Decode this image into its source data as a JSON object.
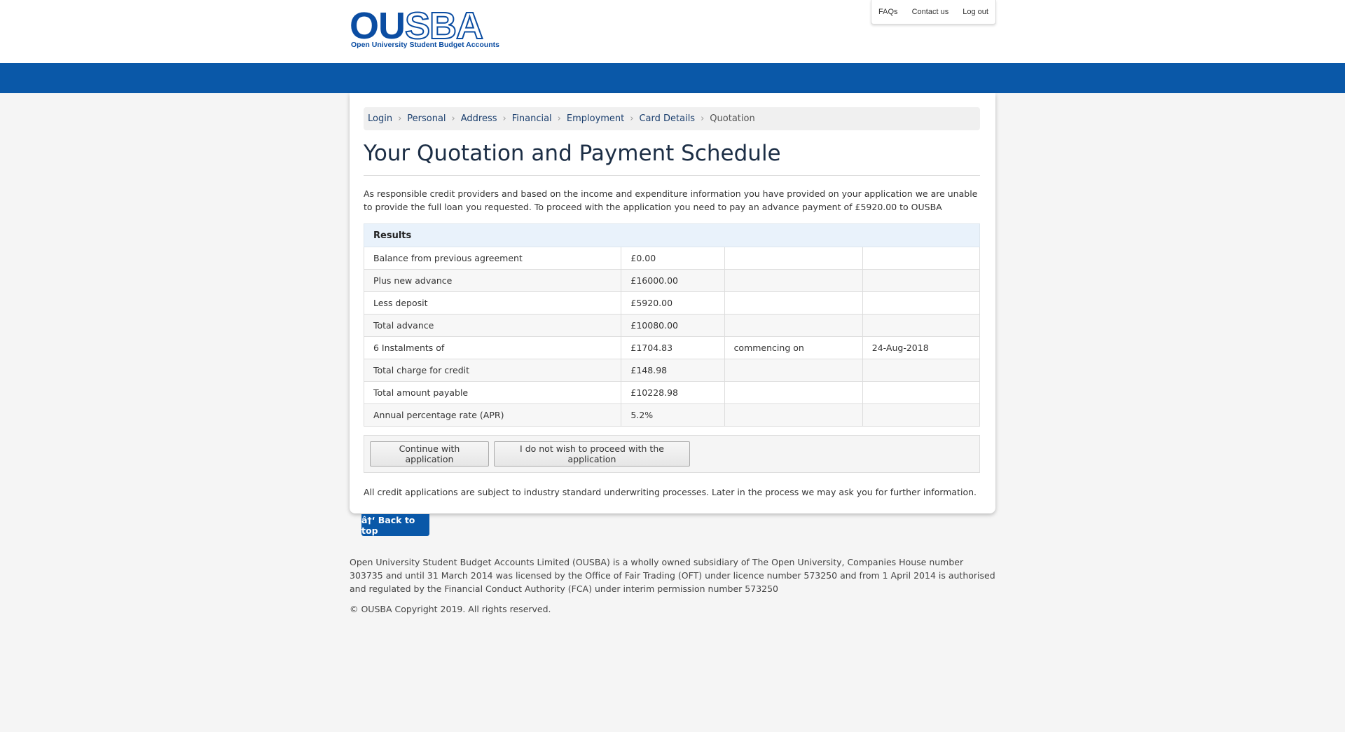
{
  "header": {
    "logo_word_ou": "OU",
    "logo_word_sba": "SBA",
    "logo_tagline": "Open University Student Budget Accounts",
    "links": [
      "FAQs",
      "Contact us",
      "Log out"
    ]
  },
  "breadcrumb": [
    "Login",
    "Personal",
    "Address",
    "Financial",
    "Employment",
    "Card Details",
    "Quotation"
  ],
  "page_title": "Your Quotation and Payment Schedule",
  "intro": "As responsible credit providers and based on the income and expenditure information you have provided on your application we are unable to provide the full loan you requested. To proceed with the application you need to pay an advance payment of £5920.00 to OUSBA",
  "results": {
    "heading": "Results",
    "rows": [
      {
        "label": "Balance from previous agreement",
        "value": "£0.00",
        "extra_label": "",
        "extra_value": ""
      },
      {
        "label": "Plus new advance",
        "value": "£16000.00",
        "extra_label": "",
        "extra_value": ""
      },
      {
        "label": "Less deposit",
        "value": "£5920.00",
        "extra_label": "",
        "extra_value": ""
      },
      {
        "label": "Total advance",
        "value": "£10080.00",
        "extra_label": "",
        "extra_value": ""
      },
      {
        "label": "6 Instalments of",
        "value": "£1704.83",
        "extra_label": "commencing on",
        "extra_value": "24-Aug-2018"
      },
      {
        "label": "Total charge for credit",
        "value": "£148.98",
        "extra_label": "",
        "extra_value": ""
      },
      {
        "label": "Total amount payable",
        "value": "£10228.98",
        "extra_label": "",
        "extra_value": ""
      },
      {
        "label": "Annual percentage rate (APR)",
        "value": "5.2%",
        "extra_label": "",
        "extra_value": ""
      }
    ]
  },
  "actions": {
    "continue_label": "Continue with application",
    "decline_label": "I do not wish to proceed with the application"
  },
  "disclaimer": "All credit applications are subject to industry standard underwriting processes. Later in the process we may ask you for further information.",
  "back_to_top": "â†‘ Back to top",
  "footer": {
    "legal": "Open University Student Budget Accounts Limited (OUSBA) is a wholly owned subsidiary of The Open University, Companies House number 303735 and until 31 March 2014 was licensed by the Office of Fair Trading (OFT) under licence number 573250 and from 1 April 2014 is authorised and regulated by the Financial Conduct Authority (FCA) under interim permission number 573250",
    "copyright": "© OUSBA Copyright 2019. All rights reserved."
  },
  "colors": {
    "brand_blue": "#0a58a8",
    "logo_blue": "#0b4da2",
    "results_header_bg": "#e9f2fb"
  }
}
